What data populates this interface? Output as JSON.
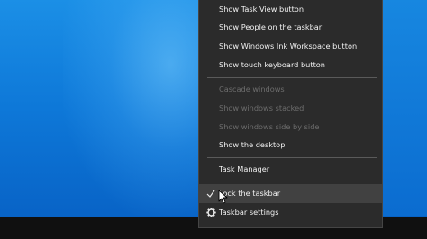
{
  "context_menu": {
    "items": [
      {
        "label": "Show Task View button",
        "enabled": true
      },
      {
        "label": "Show People on the taskbar",
        "enabled": true
      },
      {
        "label": "Show Windows Ink Workspace button",
        "enabled": true
      },
      {
        "label": "Show touch keyboard button",
        "enabled": true
      },
      {
        "label": "Cascade windows",
        "enabled": false
      },
      {
        "label": "Show windows stacked",
        "enabled": false
      },
      {
        "label": "Show windows side by side",
        "enabled": false
      },
      {
        "label": "Show the desktop",
        "enabled": true
      },
      {
        "label": "Task Manager",
        "enabled": true
      },
      {
        "label": "Lock the taskbar",
        "enabled": true,
        "checked": true,
        "hovered": true
      },
      {
        "label": "Taskbar settings",
        "enabled": true,
        "icon": "gear-icon"
      }
    ]
  },
  "colors": {
    "menu_background": "#2b2b2b",
    "hover_background": "#414141",
    "desktop_accent": "#0e78d8",
    "taskbar": "#101010"
  }
}
